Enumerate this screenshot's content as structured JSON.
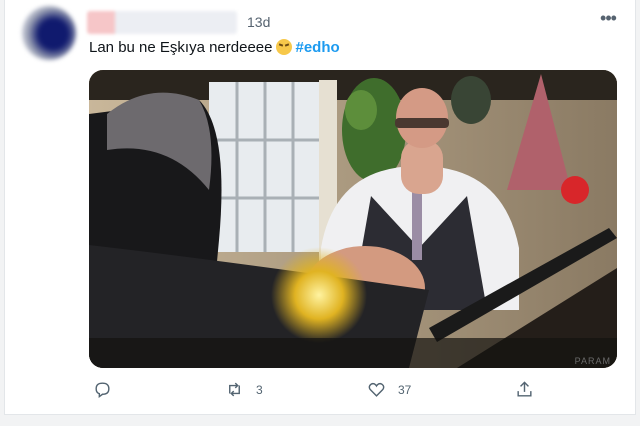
{
  "tweet": {
    "timestamp": "13d",
    "text_main": "Lan bu ne Eşkıya nerdeeee",
    "emoji_name": "angry-face-emoji",
    "hashtag": "#edho",
    "more_icon": "more-horizontal-icon"
  },
  "media": {
    "watermark": "PARAM"
  },
  "actions": {
    "reply": {
      "icon": "reply-icon",
      "count": ""
    },
    "retweet": {
      "icon": "retweet-icon",
      "count": "3"
    },
    "like": {
      "icon": "like-icon",
      "count": "37"
    },
    "share": {
      "icon": "share-icon",
      "count": ""
    }
  },
  "colors": {
    "accent": "#1d9bf0",
    "text": "#0f1419",
    "muted": "#536471"
  }
}
